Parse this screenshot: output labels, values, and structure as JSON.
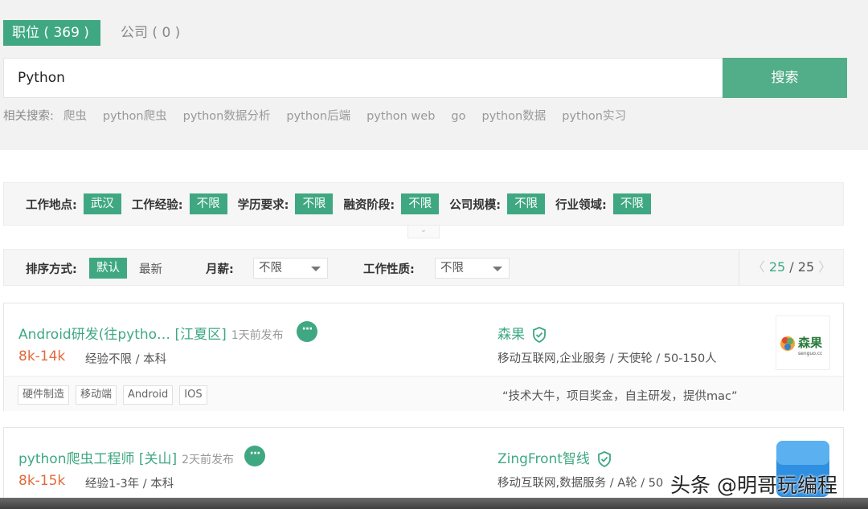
{
  "tabs": [
    {
      "label": "职位 ( 369 )",
      "active": true
    },
    {
      "label": "公司 ( 0 )",
      "active": false
    }
  ],
  "search": {
    "value": "Python",
    "button_label": "搜索"
  },
  "related": {
    "label": "相关搜索:",
    "items": [
      "爬虫",
      "python爬虫",
      "python数据分析",
      "python后端",
      "python web",
      "go",
      "python数据",
      "python实习"
    ]
  },
  "filters": [
    {
      "label": "工作地点:",
      "value": "武汉"
    },
    {
      "label": "工作经验:",
      "value": "不限"
    },
    {
      "label": "学历要求:",
      "value": "不限"
    },
    {
      "label": "融资阶段:",
      "value": "不限"
    },
    {
      "label": "公司规模:",
      "value": "不限"
    },
    {
      "label": "行业领域:",
      "value": "不限"
    }
  ],
  "sort": {
    "label": "排序方式:",
    "default": "默认",
    "newest": "最新",
    "salary_label": "月薪:",
    "salary_value": "不限",
    "nature_label": "工作性质:",
    "nature_value": "不限"
  },
  "pager": {
    "current": "25",
    "sep": "/",
    "total": "25"
  },
  "jobs": [
    {
      "title": "Android研发(往pytho… [江夏区]",
      "time": "1天前发布",
      "salary": "8k-14k",
      "requirements": "经验不限 / 本科",
      "company": "森果",
      "industry": "移动互联网,企业服务 / 天使轮 / 50-150人",
      "logo_text": "森果",
      "logo_sub": "senguo.cc",
      "tags": [
        "硬件制造",
        "移动端",
        "Android",
        "IOS"
      ],
      "slogan": "“技术大牛，项目奖金，自主研发，提供mac”"
    },
    {
      "title": "python爬虫工程师 [关山]",
      "time": "2天前发布",
      "salary": "8k-15k",
      "requirements": "经验1-3年 / 本科",
      "company": "ZingFront智线",
      "industry": "移动互联网,数据服务 / A轮 / 50"
    }
  ],
  "watermark": "头条 @明哥玩编程",
  "colors": {
    "accent": "#3fa882",
    "salary": "#e4693b"
  }
}
